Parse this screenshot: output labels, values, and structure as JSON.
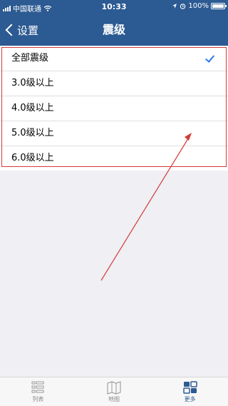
{
  "status_bar": {
    "carrier": "中国联通",
    "time": "10:33",
    "battery": "100%"
  },
  "nav": {
    "back_label": "设置",
    "title": "震级"
  },
  "magnitude_options": [
    {
      "label": "全部震级",
      "selected": true
    },
    {
      "label": "3.0级以上",
      "selected": false
    },
    {
      "label": "4.0级以上",
      "selected": false
    },
    {
      "label": "5.0级以上",
      "selected": false
    },
    {
      "label": "6.0级以上",
      "selected": false
    }
  ],
  "tabs": [
    {
      "label": "列表",
      "icon": "list-icon",
      "active": false
    },
    {
      "label": "地图",
      "icon": "map-icon",
      "active": false
    },
    {
      "label": "更多",
      "icon": "more-icon",
      "active": true
    }
  ],
  "colors": {
    "nav_bg": "#2c5a92",
    "accent": "#2f7ae5",
    "annotation": "#d33a3a"
  }
}
